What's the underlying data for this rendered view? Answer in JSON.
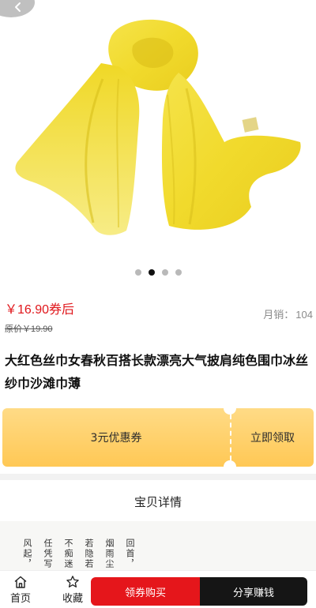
{
  "product": {
    "image_alt": "yellow-silk-scarf",
    "carousel": {
      "count": 4,
      "active_index": 1
    },
    "price": "￥16.90券后",
    "original_price": "原价￥19.90",
    "sales_label": "月销：",
    "sales_value": "104",
    "title": "大红色丝巾女春秋百搭长款漂亮大气披肩纯色围巾冰丝纱巾沙滩巾薄"
  },
  "coupon": {
    "label": "3元优惠券",
    "action": "立即领取",
    "color_top": "#ffdb86",
    "color_bottom": "#ffc855"
  },
  "detail": {
    "heading": "宝贝详情",
    "poem_columns": [
      "回首，",
      "烟雨尘",
      "若隐若",
      "不痴迷",
      "任凭写",
      "风起，"
    ]
  },
  "bottom_bar": {
    "home_label": "首页",
    "home_icon": "home-icon",
    "fav_label": "收藏",
    "fav_icon": "star-icon",
    "coupon_button": "领券购买",
    "share_button": "分享赚钱",
    "accent_red": "#e5161b",
    "accent_black": "#151515"
  }
}
